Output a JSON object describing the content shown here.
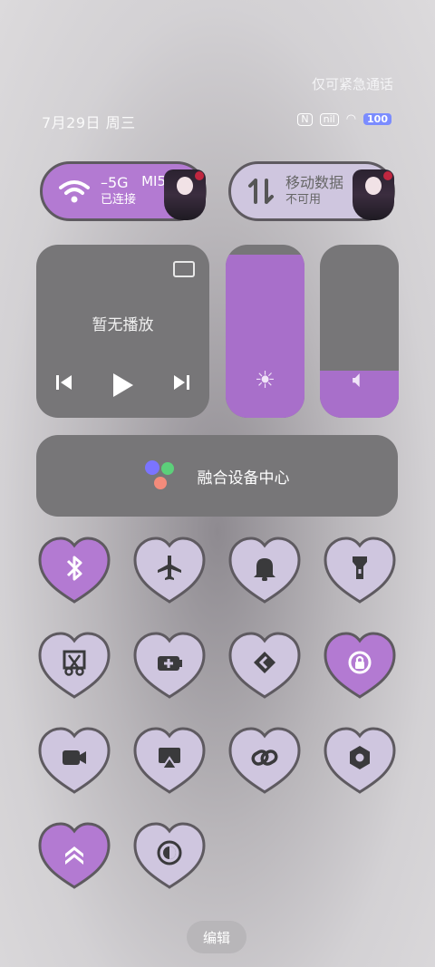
{
  "status": {
    "emergency": "仅可紧急通话",
    "date": "7月29日 周三",
    "battery": "100"
  },
  "tiles": {
    "wifi": {
      "line1": "5G",
      "line2": "已连接",
      "extra": "MI5"
    },
    "data": {
      "line1": "移动数据",
      "line2": "不可用"
    }
  },
  "media": {
    "no_playback": "暂无播放"
  },
  "sliders": {
    "brightness": 0.94,
    "volume": 0.27
  },
  "fusion": {
    "label": "融合设备中心"
  },
  "toggles": [
    {
      "icon": "bluetooth-icon",
      "active": true
    },
    {
      "icon": "airplane-icon",
      "active": false
    },
    {
      "icon": "bell-icon",
      "active": false
    },
    {
      "icon": "flashlight-icon",
      "active": false
    },
    {
      "icon": "screenshot-icon",
      "active": false
    },
    {
      "icon": "battery-saver-icon",
      "active": false
    },
    {
      "icon": "nearby-share-icon",
      "active": false
    },
    {
      "icon": "rotation-lock-icon",
      "active": true
    },
    {
      "icon": "screen-record-icon",
      "active": false
    },
    {
      "icon": "screen-cast-icon",
      "active": false
    },
    {
      "icon": "link-icon",
      "active": false
    },
    {
      "icon": "nfc-icon",
      "active": false
    },
    {
      "icon": "performance-mode-icon",
      "active": true
    },
    {
      "icon": "dark-mode-icon",
      "active": false
    }
  ],
  "colors": {
    "active": "#b37ad2",
    "inactive": "#cfc6df",
    "outline": "#5e5a60",
    "glyph_dark": "#3a3a3c",
    "glyph_light": "#ffffff"
  },
  "edit_label": "编辑"
}
